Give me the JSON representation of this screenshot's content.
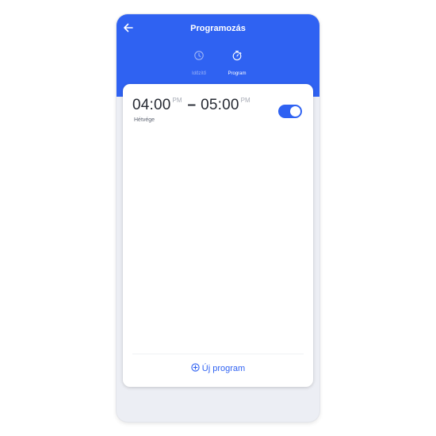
{
  "header": {
    "title": "Programozás",
    "back_icon": "arrow-left-icon",
    "background_color": "#2f62f2"
  },
  "tabs": [
    {
      "label": "Időzítő",
      "icon": "clock-icon",
      "active": false
    },
    {
      "label": "Program",
      "icon": "stopwatch-icon",
      "active": true
    }
  ],
  "programs": [
    {
      "start_time": "04:00",
      "start_period": "PM",
      "separator": "–",
      "end_time": "05:00",
      "end_period": "PM",
      "days": "Hétvége",
      "enabled": true
    }
  ],
  "add_button": {
    "label": "Új program",
    "icon": "plus-circle-icon"
  },
  "colors": {
    "accent": "#2f62f2",
    "background": "#eceef4",
    "card": "#ffffff"
  }
}
